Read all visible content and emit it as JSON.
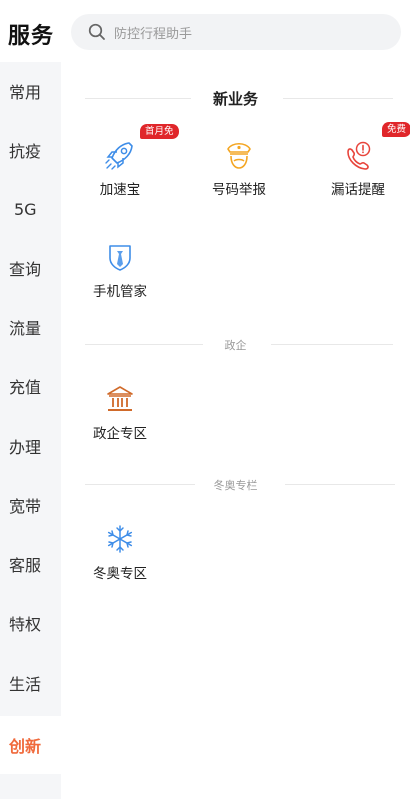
{
  "header": {
    "title": "服务",
    "search_placeholder": "防控行程助手"
  },
  "sidebar": {
    "items": [
      {
        "label": "常用"
      },
      {
        "label": "抗疫"
      },
      {
        "label": "5G"
      },
      {
        "label": "查询"
      },
      {
        "label": "流量"
      },
      {
        "label": "充值"
      },
      {
        "label": "办理"
      },
      {
        "label": "宽带"
      },
      {
        "label": "客服"
      },
      {
        "label": "特权"
      },
      {
        "label": "生活"
      },
      {
        "label": "创新"
      }
    ],
    "active": "创新",
    "active_color": "#f06a3c"
  },
  "sections": [
    {
      "title": "新业务",
      "items": [
        {
          "label": "加速宝",
          "icon": "rocket-icon",
          "badge": "首月免"
        },
        {
          "label": "号码举报",
          "icon": "police-icon"
        },
        {
          "label": "漏话提醒",
          "icon": "missed-call-icon",
          "badge": "免费"
        },
        {
          "label": "手机管家",
          "icon": "shield-icon"
        }
      ]
    },
    {
      "title": "政企",
      "items": [
        {
          "label": "政企专区",
          "icon": "government-building-icon"
        }
      ]
    },
    {
      "title": "冬奥专栏",
      "items": [
        {
          "label": "冬奥专区",
          "icon": "snowflake-icon"
        }
      ]
    }
  ],
  "colors": {
    "badge": "#e0262a",
    "icon_blue": "#3e8de8",
    "icon_orange": "#f4a623",
    "icon_red": "#e8453c",
    "icon_brown": "#d06a2a"
  }
}
